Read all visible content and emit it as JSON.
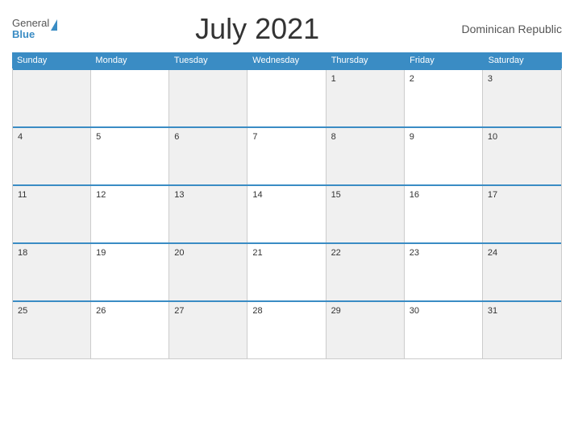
{
  "header": {
    "title": "July 2021",
    "country": "Dominican Republic",
    "logo": {
      "general": "General",
      "blue": "Blue"
    }
  },
  "days": {
    "headers": [
      "Sunday",
      "Monday",
      "Tuesday",
      "Wednesday",
      "Thursday",
      "Friday",
      "Saturday"
    ]
  },
  "weeks": [
    {
      "cells": [
        {
          "date": "",
          "empty": true
        },
        {
          "date": "",
          "empty": true
        },
        {
          "date": "",
          "empty": true
        },
        {
          "date": "",
          "empty": true
        },
        {
          "date": "1",
          "empty": false
        },
        {
          "date": "2",
          "empty": false
        },
        {
          "date": "3",
          "empty": false
        }
      ]
    },
    {
      "cells": [
        {
          "date": "4",
          "empty": false
        },
        {
          "date": "5",
          "empty": false
        },
        {
          "date": "6",
          "empty": false
        },
        {
          "date": "7",
          "empty": false
        },
        {
          "date": "8",
          "empty": false
        },
        {
          "date": "9",
          "empty": false
        },
        {
          "date": "10",
          "empty": false
        }
      ]
    },
    {
      "cells": [
        {
          "date": "11",
          "empty": false
        },
        {
          "date": "12",
          "empty": false
        },
        {
          "date": "13",
          "empty": false
        },
        {
          "date": "14",
          "empty": false
        },
        {
          "date": "15",
          "empty": false
        },
        {
          "date": "16",
          "empty": false
        },
        {
          "date": "17",
          "empty": false
        }
      ]
    },
    {
      "cells": [
        {
          "date": "18",
          "empty": false
        },
        {
          "date": "19",
          "empty": false
        },
        {
          "date": "20",
          "empty": false
        },
        {
          "date": "21",
          "empty": false
        },
        {
          "date": "22",
          "empty": false
        },
        {
          "date": "23",
          "empty": false
        },
        {
          "date": "24",
          "empty": false
        }
      ]
    },
    {
      "cells": [
        {
          "date": "25",
          "empty": false
        },
        {
          "date": "26",
          "empty": false
        },
        {
          "date": "27",
          "empty": false
        },
        {
          "date": "28",
          "empty": false
        },
        {
          "date": "29",
          "empty": false
        },
        {
          "date": "30",
          "empty": false
        },
        {
          "date": "31",
          "empty": false
        }
      ]
    }
  ],
  "colors": {
    "accent": "#3a8cc4",
    "header_bg": "#3a8cc4",
    "shaded_cell": "#f0f0f0"
  }
}
